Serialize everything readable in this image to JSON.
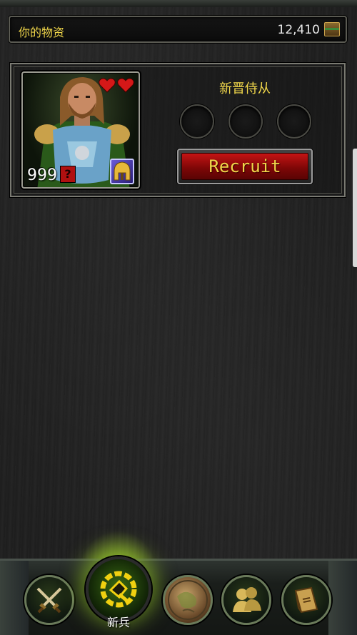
{
  "resources": {
    "title": "你的物资",
    "amount": "12,410",
    "icon": "chest-icon"
  },
  "unit_card": {
    "name": "新晋侍从",
    "level": "999",
    "hearts": 2,
    "recruit_label": "Recruit",
    "slots": [
      {
        "state": "empty"
      },
      {
        "state": "empty"
      },
      {
        "state": "empty"
      }
    ]
  },
  "bottom_nav": {
    "items": [
      {
        "icon": "crossed-swords-icon"
      },
      {
        "icon": "recruit-emblem-icon",
        "label": "新兵",
        "active": true
      },
      {
        "icon": "world-map-icon"
      },
      {
        "icon": "party-silhouettes-icon"
      },
      {
        "icon": "book-icon"
      }
    ]
  },
  "colors": {
    "gold_text": "#f0d64a",
    "recruit_red": "#c41414",
    "active_glow": "#aae628"
  }
}
